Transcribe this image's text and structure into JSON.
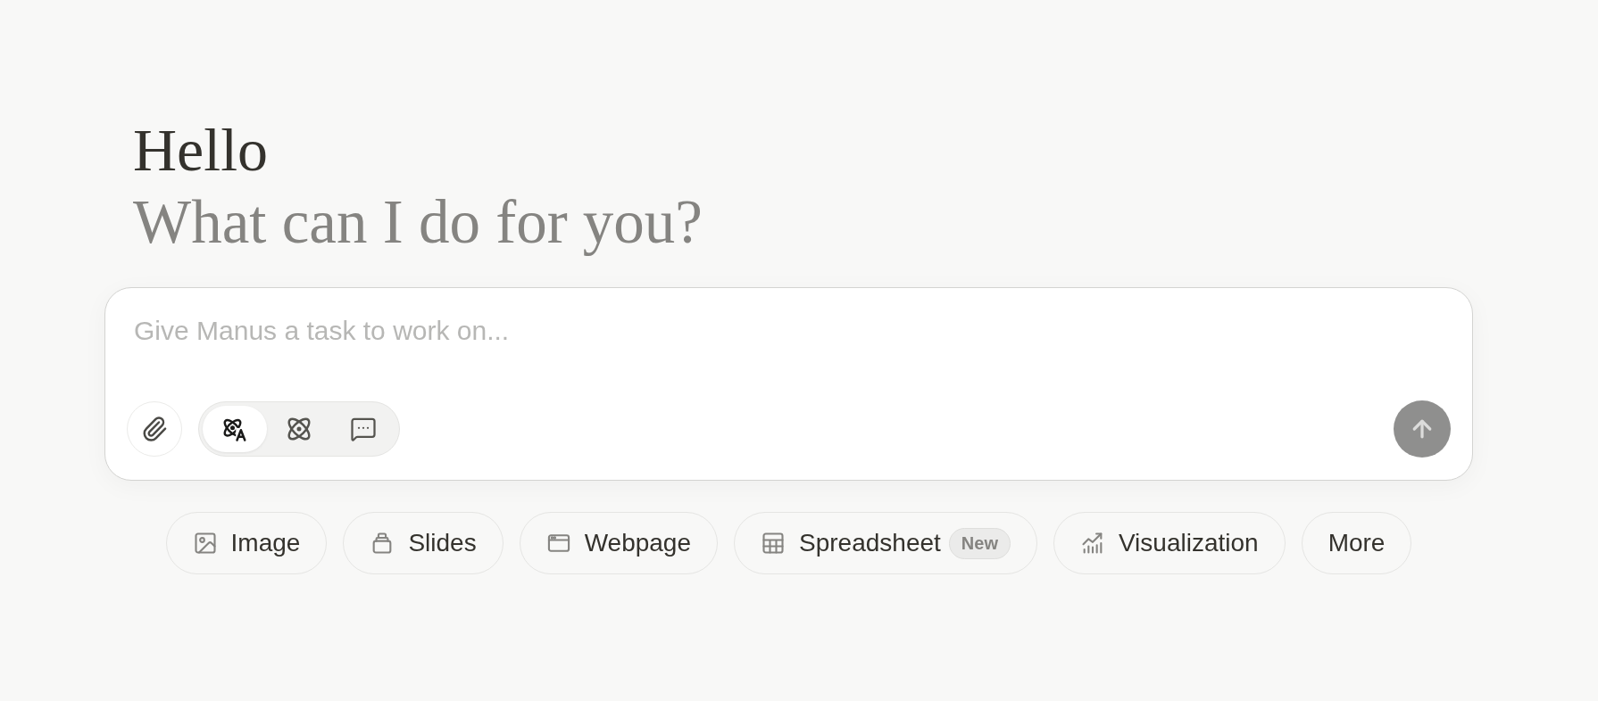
{
  "greeting": {
    "title": "Hello",
    "subtitle": "What can I do for you?"
  },
  "composer": {
    "placeholder": "Give Manus a task to work on...",
    "modes": [
      {
        "kind": "atom_letter",
        "selected": true
      },
      {
        "kind": "atom",
        "selected": false
      },
      {
        "kind": "chat",
        "selected": false
      }
    ],
    "send_button": {
      "disabled": true
    }
  },
  "quick_actions": [
    {
      "kind": "image",
      "label": "Image"
    },
    {
      "kind": "slides",
      "label": "Slides"
    },
    {
      "kind": "webpage",
      "label": "Webpage"
    },
    {
      "kind": "spreadsheet",
      "label": "Spreadsheet",
      "badge": "New"
    },
    {
      "kind": "visualization",
      "label": "Visualization"
    },
    {
      "kind": "more",
      "label": "More"
    }
  ]
}
